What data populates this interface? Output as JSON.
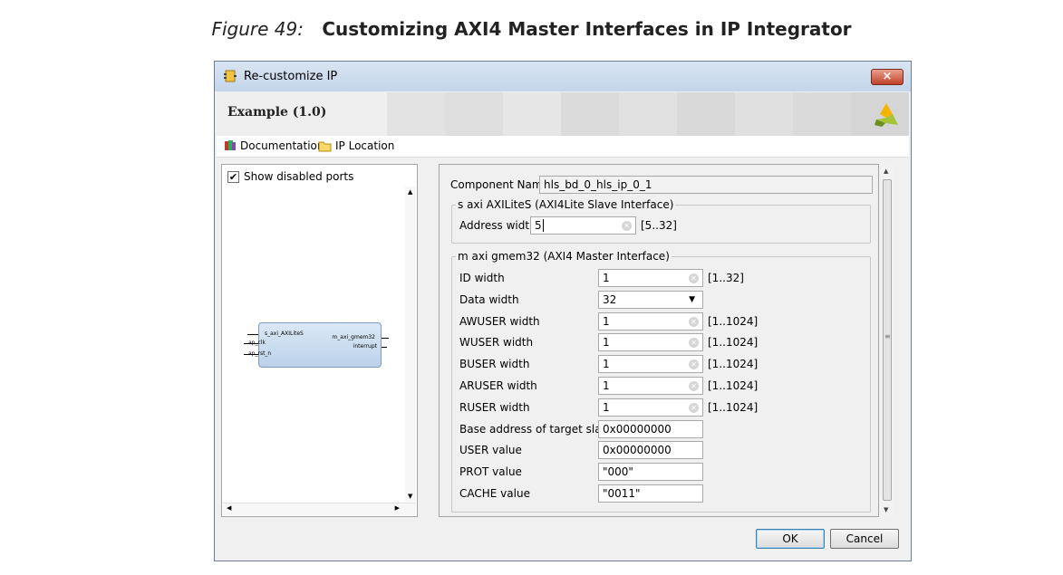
{
  "caption": {
    "figure_label": "Figure 49:",
    "title": "Customizing AXI4 Master Interfaces in IP Integrator"
  },
  "window": {
    "title": "Re-customize IP",
    "close_label": "×",
    "banner_title": "Example (1.0)"
  },
  "links": {
    "documentation": "Documentation",
    "ip_location": "IP Location"
  },
  "left_panel": {
    "show_disabled_ports_label": "Show disabled ports",
    "show_disabled_ports_checked": true,
    "block": {
      "port_s_axi": "s_axi_AXILiteS",
      "port_clk": "ap_clk",
      "port_rst": "ap_rst_n",
      "port_m_axi": "m_axi_gmem32",
      "port_interrupt": "interrupt"
    }
  },
  "form": {
    "component_name_label": "Component Name",
    "component_name_value": "hls_bd_0_hls_ip_0_1",
    "s_axi_group": {
      "legend": "s axi AXILiteS (AXI4Lite Slave Interface)",
      "address_width_label": "Address width",
      "address_width_value": "5",
      "address_width_range": "[5..32]"
    },
    "m_axi_group": {
      "legend": "m axi gmem32 (AXI4 Master Interface)",
      "rows": [
        {
          "label": "ID width",
          "value": "1",
          "range": "[1..32]",
          "kind": "clearable"
        },
        {
          "label": "Data width",
          "value": "32",
          "range": "",
          "kind": "dropdown"
        },
        {
          "label": "AWUSER width",
          "value": "1",
          "range": "[1..1024]",
          "kind": "clearable"
        },
        {
          "label": "WUSER width",
          "value": "1",
          "range": "[1..1024]",
          "kind": "clearable"
        },
        {
          "label": "BUSER width",
          "value": "1",
          "range": "[1..1024]",
          "kind": "clearable"
        },
        {
          "label": "ARUSER width",
          "value": "1",
          "range": "[1..1024]",
          "kind": "clearable"
        },
        {
          "label": "RUSER width",
          "value": "1",
          "range": "[1..1024]",
          "kind": "clearable"
        },
        {
          "label": "Base address of target slave",
          "value": "0x00000000",
          "range": "",
          "kind": "text"
        },
        {
          "label": "USER value",
          "value": "0x00000000",
          "range": "",
          "kind": "text"
        },
        {
          "label": "PROT value",
          "value": "\"000\"",
          "range": "",
          "kind": "text"
        },
        {
          "label": "CACHE value",
          "value": "\"0011\"",
          "range": "",
          "kind": "text"
        }
      ]
    }
  },
  "buttons": {
    "ok": "OK",
    "cancel": "Cancel"
  },
  "colors": {
    "title_bar": "#c4d5ea",
    "close_button": "#c0412a",
    "block_fill": "#bcd2ea",
    "ok_focus": "#3c7fb1"
  }
}
